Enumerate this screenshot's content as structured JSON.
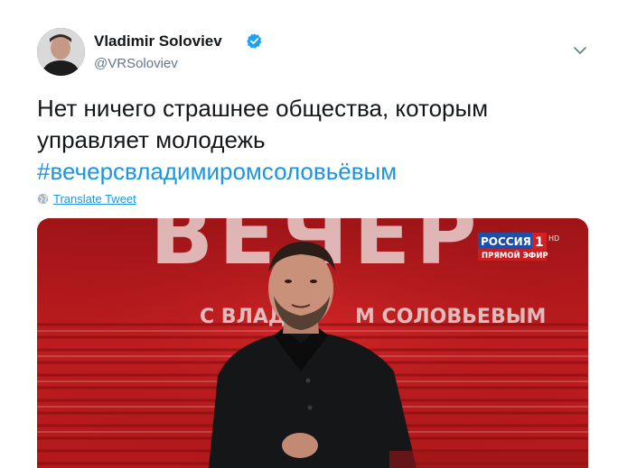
{
  "author": {
    "name": "Vladimir Soloviev",
    "handle": "@VRSoloviev",
    "avatar_icon": "person-avatar",
    "verified_icon": "verified-badge-icon"
  },
  "tweet": {
    "text": "Нет ничего страшнее общества, которым управляет молодежь",
    "hashtag": "#вечерсвладимиромсоловьёвым",
    "translate_label": "Translate Tweet"
  },
  "media": {
    "show_title": "ВЕЧЕР",
    "show_subtitle_left": "С ВЛАД",
    "show_subtitle_right": "М СОЛОВЬЕВЫМ",
    "channel_name": "РОССИЯ",
    "channel_number": "1",
    "channel_hd": "HD",
    "live_label": "ПРЯМОЙ ЭФИР"
  },
  "colors": {
    "link": "#1b95e0",
    "handle": "#657786",
    "studio_red": "#b5181b",
    "verified": "#1da1f2"
  }
}
